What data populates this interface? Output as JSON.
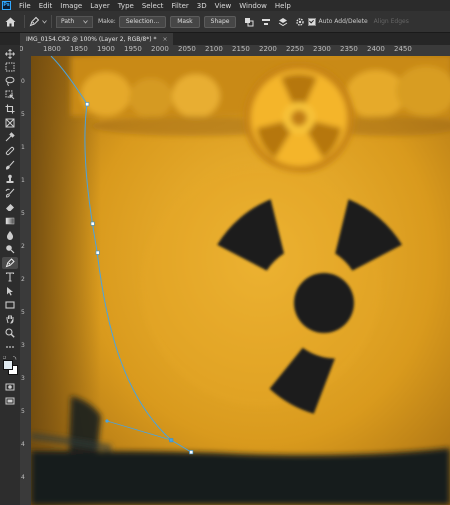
{
  "menubar": {
    "app_logo": "Ps",
    "items": [
      "File",
      "Edit",
      "Image",
      "Layer",
      "Type",
      "Select",
      "Filter",
      "3D",
      "View",
      "Window",
      "Help"
    ]
  },
  "options_bar": {
    "tool_mode": "Path",
    "make_label": "Make:",
    "selection_button": "Selection...",
    "mask_button": "Mask",
    "shape_button": "Shape",
    "auto_add_delete": {
      "label": "Auto Add/Delete",
      "checked": true
    },
    "align_edges": {
      "label": "Align Edges",
      "enabled": false
    }
  },
  "document_tab": {
    "title": "IMG_0154.CR2 @ 100% (Layer 2, RGB/8*) *",
    "close": "×"
  },
  "ruler_top": {
    "labels": [
      "0",
      "1800",
      "1850",
      "1900",
      "1950",
      "2000",
      "2050",
      "2100",
      "2150",
      "2200",
      "2250",
      "2300",
      "2350",
      "2400",
      "2450"
    ]
  },
  "ruler_left": {
    "labels": [
      "0",
      "5",
      "1",
      "1",
      "5",
      "2",
      "2",
      "5",
      "3",
      "3",
      "5",
      "4",
      "4"
    ]
  },
  "toolbar": {
    "tools": [
      "move-tool",
      "marquee-tool",
      "lasso-tool",
      "object-selection-tool",
      "crop-tool",
      "frame-tool",
      "eyedropper-tool",
      "healing-brush-tool",
      "brush-tool",
      "clone-stamp-tool",
      "history-brush-tool",
      "eraser-tool",
      "gradient-tool",
      "blur-tool",
      "dodge-tool",
      "pen-tool",
      "type-tool",
      "path-selection-tool",
      "rectangle-tool",
      "hand-tool",
      "zoom-tool",
      "more-tools"
    ],
    "active_tool": "pen-tool",
    "foreground_color": "#dfe9ef",
    "background_color": "#ffffff"
  },
  "colors": {
    "ui_bg": "#323232",
    "path_stroke": "#4aa3df",
    "image_yellow": "#d79519",
    "symbol_dark": "#1a1e1e"
  }
}
